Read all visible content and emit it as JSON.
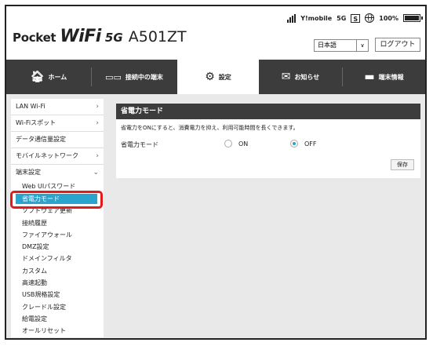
{
  "header": {
    "logo_pocket": "Pocket",
    "logo_wifi": "WiFi",
    "logo_5g": "5G",
    "model": "A501ZT",
    "carrier": "Y!mobile",
    "network": "5G",
    "sim_badge": "S",
    "battery": "100%",
    "language_selected": "日本語",
    "logout_label": "ログアウト"
  },
  "nav": {
    "tabs": [
      {
        "label": "ホーム",
        "icon": "home-icon"
      },
      {
        "label": "接続中の端末",
        "icon": "devices-icon"
      },
      {
        "label": "設定",
        "icon": "gear-icon"
      },
      {
        "label": "お知らせ",
        "icon": "mail-icon"
      },
      {
        "label": "端末情報",
        "icon": "device-info-icon"
      }
    ],
    "active": "設定"
  },
  "sidebar": {
    "items": [
      {
        "label": "LAN Wi-Fi",
        "chevron": "›"
      },
      {
        "label": "Wi-Fiスポット",
        "chevron": "›"
      },
      {
        "label": "データ通信量設定",
        "chevron": ""
      },
      {
        "label": "モバイルネットワーク",
        "chevron": "›"
      },
      {
        "label": "端末設定",
        "chevron": "⌄"
      }
    ],
    "sub_items": [
      "Web UIパスワード",
      "省電力モード",
      "ソフトウェア更新",
      "接続履歴",
      "ファイアウォール",
      "DMZ設定",
      "ドメインフィルタ",
      "カスタム",
      "高速起動",
      "USB規格設定",
      "クレードル設定",
      "給電設定",
      "オールリセット"
    ],
    "selected_sub": "省電力モード"
  },
  "panel": {
    "title": "省電力モード",
    "description": "省電力をONにすると、消費電力を抑え、利用可能時間を長くできます。",
    "setting_label": "省電力モード",
    "option_on": "ON",
    "option_off": "OFF",
    "selected": "OFF",
    "save_label": "保存"
  },
  "colors": {
    "nav_bg": "#3c3c3c",
    "accent": "#2aa4cf",
    "highlight": "#e41a1a"
  }
}
